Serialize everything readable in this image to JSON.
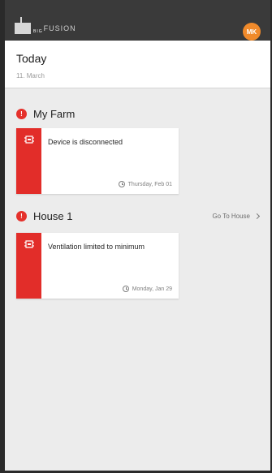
{
  "topbar": {
    "logo_brand_small": "BIG",
    "logo_text": "FUSION",
    "avatar_initials": "MK",
    "accent_color": "#f08a2b",
    "background": "#3a3a3a"
  },
  "today": {
    "title": "Today",
    "date": "11. March"
  },
  "sections": [
    {
      "title": "My Farm",
      "alert_icon": "!",
      "cards": [
        {
          "message": "Device is disconnected",
          "timestamp": "Thursday, Feb 01",
          "icon": "device-icon",
          "status_color": "#e22d29"
        }
      ]
    },
    {
      "title": "House 1",
      "alert_icon": "!",
      "link_label": "Go To House",
      "cards": [
        {
          "message": "Ventilation limited to minimum",
          "timestamp": "Monday, Jan 29",
          "icon": "ventilation-icon",
          "status_color": "#e22d29"
        }
      ]
    }
  ]
}
